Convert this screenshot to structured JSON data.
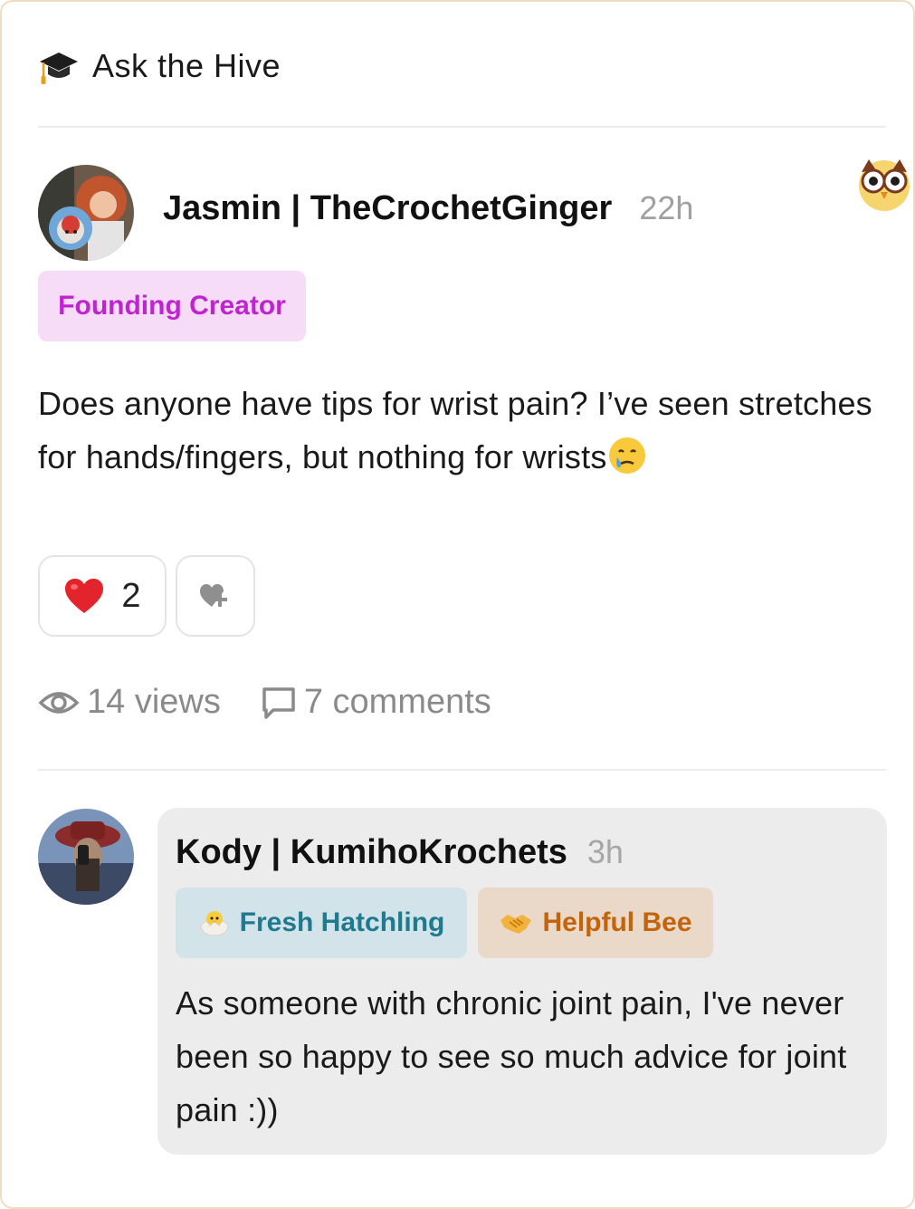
{
  "header": {
    "title": "Ask the Hive",
    "icon": "graduation-cap-icon"
  },
  "post": {
    "author": "Jasmin | TheCrochetGinger",
    "time": "22h",
    "badge": "Founding Creator",
    "body": "Does anyone have tips for wrist pain? I’ve seen stretches for hands/fingers, but nothing for wrists",
    "body_emoji": "crying-face-icon",
    "reactions": {
      "heart_count": "2"
    },
    "stats": {
      "views": "14 views",
      "comments": "7 comments"
    }
  },
  "comment": {
    "author": "Kody | KumihoKrochets",
    "time": "3h",
    "badges": [
      {
        "label": "Fresh Hatchling",
        "icon": "hatching-chick-icon"
      },
      {
        "label": "Helpful Bee",
        "icon": "handshake-icon"
      }
    ],
    "body": "As someone with chronic joint pain, I've never been so happy to see so much advice for joint pain :))"
  },
  "colors": {
    "founding_badge_bg": "#f6dcf7",
    "founding_badge_text": "#c024d0",
    "hatchling_badge_bg": "#d3e3ea",
    "hatchling_badge_text": "#1f7a8e",
    "helpful_badge_bg": "#ead9c8",
    "helpful_badge_text": "#c3630a",
    "card_border": "#f0dcc0"
  }
}
